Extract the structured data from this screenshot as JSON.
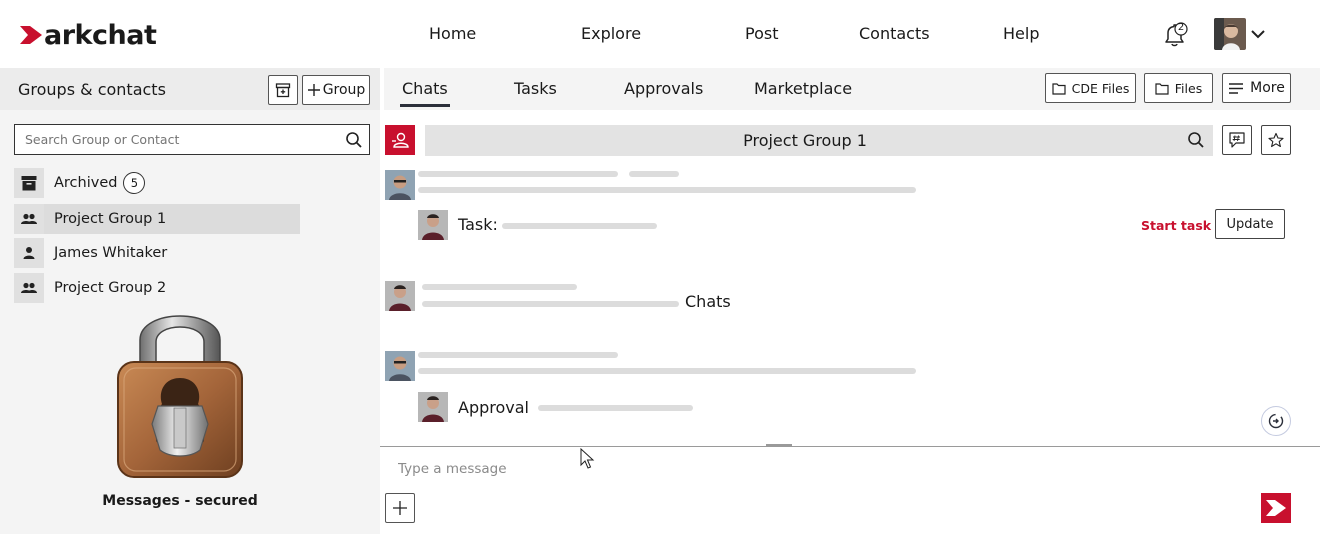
{
  "brand": {
    "logo_text": "arkchat",
    "accent": "#c8102e"
  },
  "nav": {
    "items": [
      "Home",
      "Explore",
      "Post",
      "Contacts",
      "Help"
    ],
    "notification_count": "2"
  },
  "left_panel": {
    "title": "Groups & contacts",
    "group_button_label": "Group",
    "search_placeholder": "Search Group or Contact",
    "archived": {
      "label": "Archived",
      "count": "5"
    },
    "items": [
      {
        "label": "Project Group 1",
        "type": "group",
        "selected": true
      },
      {
        "label": "James Whitaker",
        "type": "person",
        "selected": false
      },
      {
        "label": "Project Group 2",
        "type": "group",
        "selected": false
      }
    ],
    "secure_label": "Messages - secured"
  },
  "tabs": {
    "items": [
      "Chats",
      "Tasks",
      "Approvals",
      "Marketplace"
    ],
    "active": "Chats",
    "buttons": {
      "cde_files": "CDE Files",
      "files": "Files",
      "more": "More"
    }
  },
  "chat": {
    "group_title": "Project Group 1",
    "messages": {
      "task_label": "Task:",
      "chats_label": "Chats",
      "approval_label": "Approval"
    },
    "start_task_label": "Start task",
    "update_label": "Update"
  },
  "composer": {
    "placeholder": "Type a message"
  }
}
